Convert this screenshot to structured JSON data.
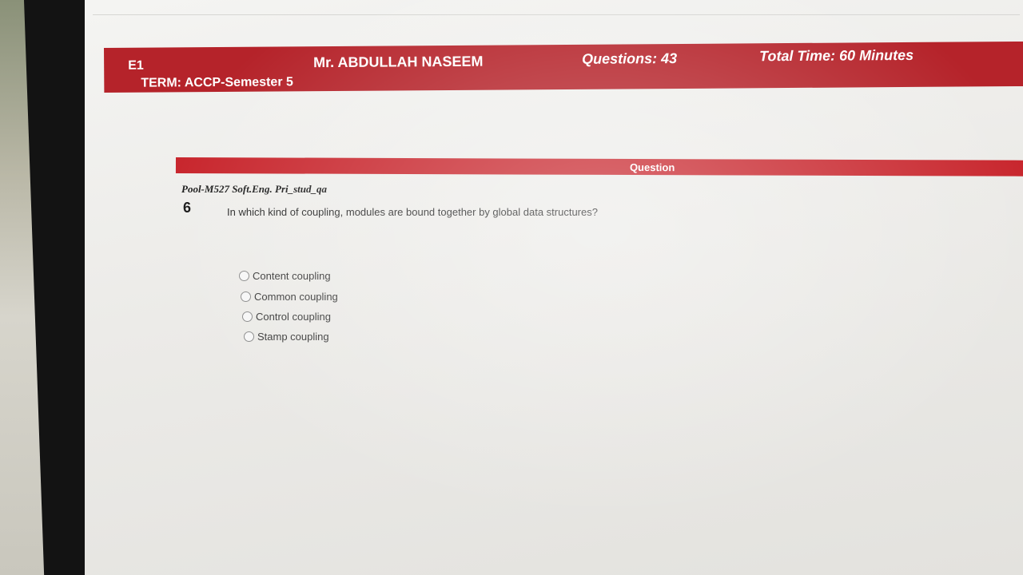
{
  "header": {
    "course_code": "E1",
    "term": "TERM: ACCP-Semester 5",
    "teacher": "Mr. ABDULLAH NASEEM",
    "questions": "Questions:  43",
    "total_time": "Total Time:  60 Minutes",
    "bar_color": "#b5232a"
  },
  "question_section": {
    "title": "Question",
    "pool": "Pool-M527 Soft.Eng. Pri_stud_qa",
    "number": "6",
    "text": "In which kind of coupling, modules are bound together by global data structures?",
    "options": [
      {
        "label": "Content coupling",
        "selected": false
      },
      {
        "label": "Common coupling",
        "selected": false
      },
      {
        "label": "Control coupling",
        "selected": false
      },
      {
        "label": "Stamp coupling",
        "selected": false
      }
    ]
  }
}
